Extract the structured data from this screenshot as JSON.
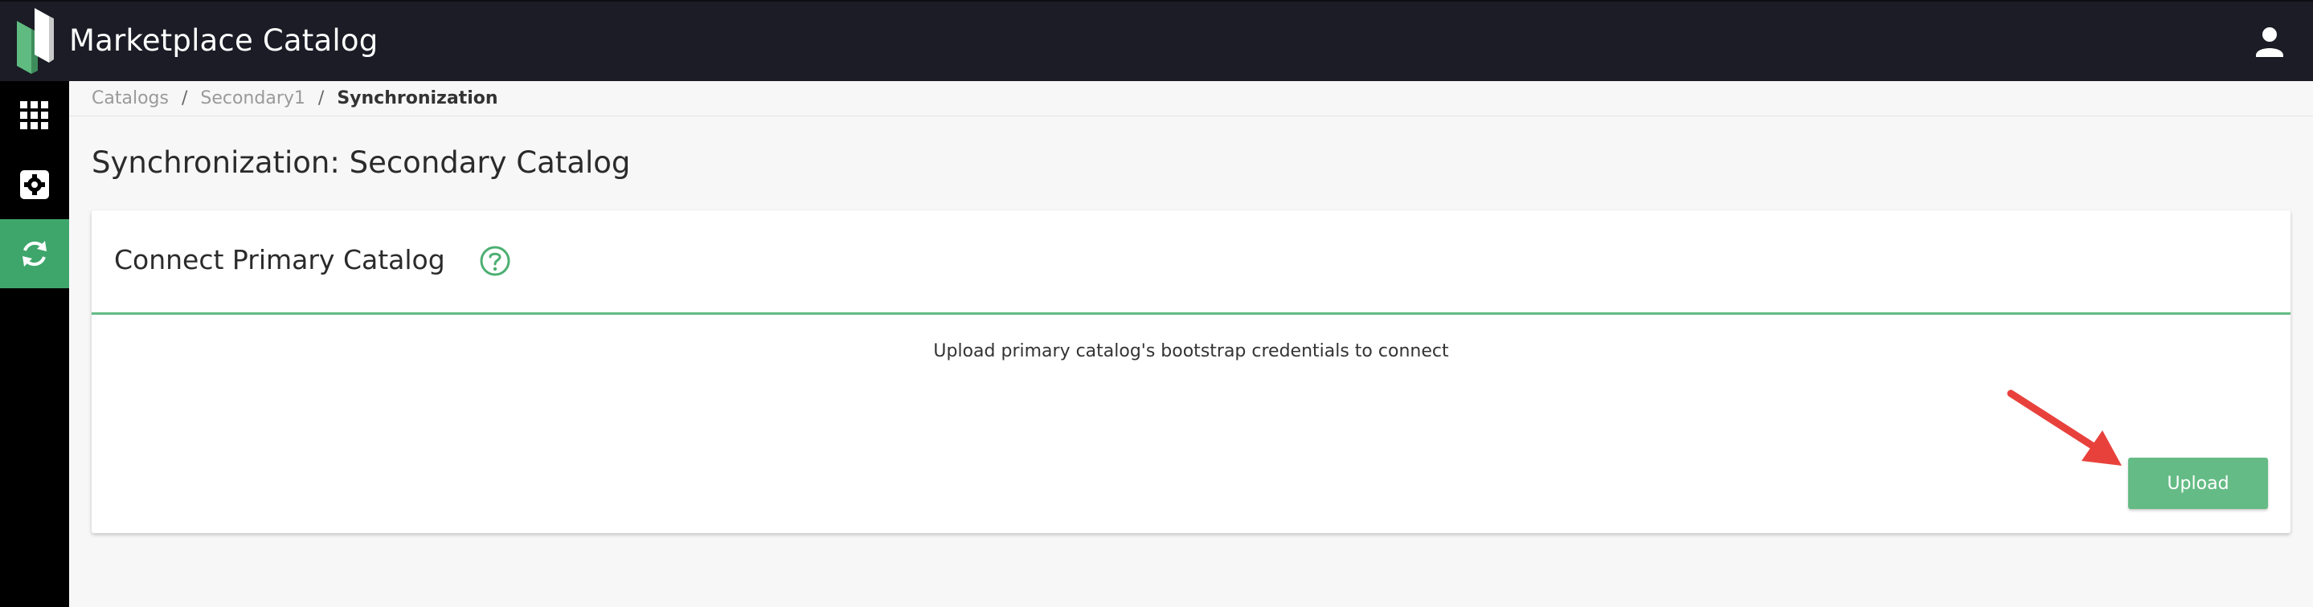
{
  "header": {
    "app_title": "Marketplace Catalog",
    "logo_icon": "marketplace-logo",
    "user_icon": "user-icon",
    "background": "#1b1c26"
  },
  "sidebar": {
    "items": [
      {
        "icon": "apps-grid-icon",
        "active": false
      },
      {
        "icon": "settings-gear-icon",
        "active": false
      },
      {
        "icon": "sync-icon",
        "active": true
      }
    ],
    "active_color": "#3fa66b"
  },
  "breadcrumb": {
    "items": [
      "Catalogs",
      "Secondary1",
      "Synchronization"
    ],
    "separator": "/"
  },
  "page": {
    "title": "Synchronization: Secondary Catalog"
  },
  "card": {
    "title": "Connect Primary Catalog",
    "help_icon": "help-circle-icon",
    "message": "Upload primary catalog's bootstrap credentials to connect",
    "upload_label": "Upload",
    "accent": "#63bb84"
  },
  "annotation": {
    "arrow_icon": "red-arrow-pointer",
    "color": "#e8413c"
  }
}
